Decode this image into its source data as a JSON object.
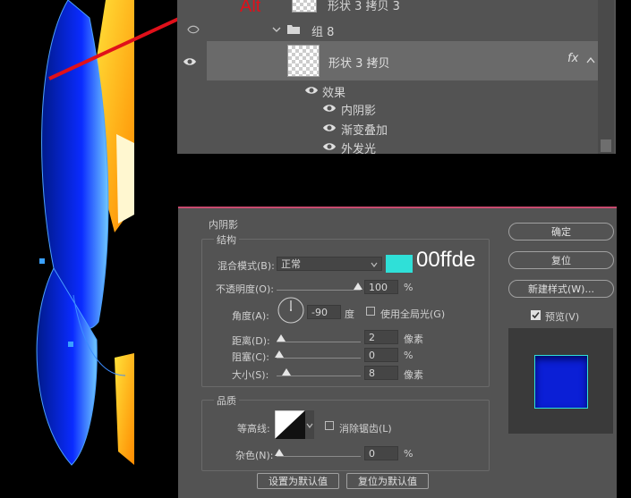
{
  "annotations": {
    "alt_label": "Alt",
    "hex_label": "00ffde",
    "swatch_color": "#2fe0d8",
    "arrow_color": "#e0101a"
  },
  "layers": {
    "top_layer": "形状 3 拷贝 3",
    "group": "组 8",
    "layer": "形状 3 拷贝",
    "fx": "fx",
    "effects": "效果",
    "effect_items": [
      "内阴影",
      "渐变叠加",
      "外发光"
    ]
  },
  "dialog": {
    "title": "内阴影",
    "structure": "结构",
    "blend_mode_label": "混合模式(B):",
    "blend_mode_value": "正常",
    "opacity_label": "不透明度(O):",
    "opacity_value": "100",
    "pct": "%",
    "angle_label": "角度(A):",
    "angle_value": "-90",
    "degree": "度",
    "global_light_label": "使用全局光(G)",
    "distance_label": "距离(D):",
    "distance_value": "2",
    "choke_label": "阻塞(C):",
    "choke_value": "0",
    "size_label": "大小(S):",
    "size_value": "8",
    "px": "像素",
    "quality": "品质",
    "contour_label": "等高线:",
    "anti_alias_label": "消除锯齿(L)",
    "noise_label": "杂色(N):",
    "noise_value": "0",
    "set_default": "设置为默认值",
    "reset_default": "复位为默认值",
    "ok": "确定",
    "reset": "复位",
    "new_style": "新建样式(W)...",
    "preview_label": "预览(V)"
  }
}
